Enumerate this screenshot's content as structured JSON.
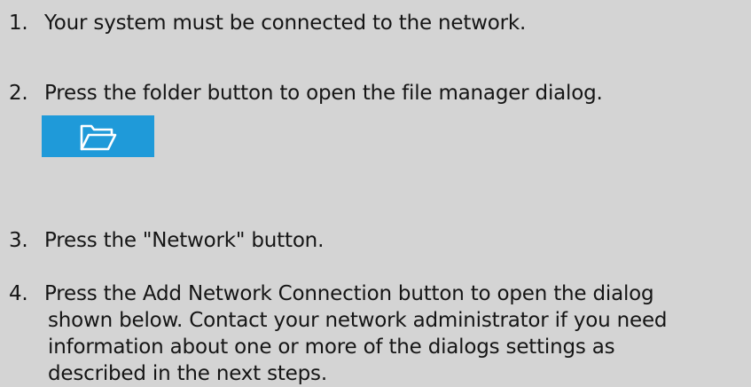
{
  "steps": [
    {
      "number": "1.",
      "text": "Your system must be connected to the network."
    },
    {
      "number": "2.",
      "text": "Press the folder button to open the file manager dialog."
    },
    {
      "number": "3.",
      "text": "Press the \"Network\" button."
    },
    {
      "number": "4.",
      "lines": [
        "Press the Add Network Connection button to open the dialog",
        "shown below. Contact your network administrator if you need",
        "information about one or more of the dialogs settings as",
        "described in the next steps."
      ]
    }
  ],
  "folder_button": {
    "icon": "folder-icon",
    "color": "#1f9ad9"
  },
  "colors": {
    "background": "#d4d4d4",
    "text": "#151515"
  }
}
